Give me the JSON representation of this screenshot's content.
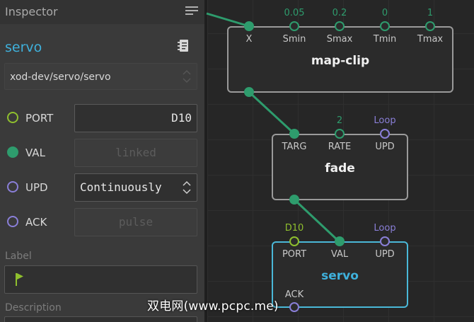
{
  "inspector": {
    "title": "Inspector",
    "node_name": "servo",
    "node_path": "xod-dev/servo/servo",
    "pins": [
      {
        "label": "PORT",
        "value": "D10",
        "state": "active"
      },
      {
        "label": "VAL",
        "value": "linked",
        "state": "disabled"
      },
      {
        "label": "UPD",
        "value": "Continuously",
        "state": "active"
      },
      {
        "label": "ACK",
        "value": "pulse",
        "state": "disabled"
      }
    ],
    "label_heading": "Label",
    "label_value": "",
    "description_heading": "Description"
  },
  "canvas": {
    "nodes": [
      {
        "title": "map-clip",
        "pins": [
          {
            "name": "X",
            "value": ""
          },
          {
            "name": "Smin",
            "value": "0.05"
          },
          {
            "name": "Smax",
            "value": "0.2"
          },
          {
            "name": "Tmin",
            "value": "0"
          },
          {
            "name": "Tmax",
            "value": "1"
          }
        ]
      },
      {
        "title": "fade",
        "pins": [
          {
            "name": "TARG",
            "value": ""
          },
          {
            "name": "RATE",
            "value": "2"
          },
          {
            "name": "UPD",
            "value": "Loop"
          }
        ]
      },
      {
        "title": "servo",
        "selected": true,
        "pins": [
          {
            "name": "PORT",
            "value": "D10"
          },
          {
            "name": "VAL",
            "value": ""
          },
          {
            "name": "UPD",
            "value": "Loop"
          },
          {
            "name": "ACK",
            "value": ""
          }
        ]
      }
    ]
  },
  "colors": {
    "accent": "#3fb1dc",
    "number_pin": "#2e9c6d",
    "port_pin": "#8fbf2e",
    "pulse_pin": "#8a7fd8"
  },
  "icons": [
    "hamburger-menu-icon",
    "document-icon",
    "up-down-arrows-icon",
    "flag-icon"
  ],
  "watermark": "双电网(www.pcpc.me)"
}
